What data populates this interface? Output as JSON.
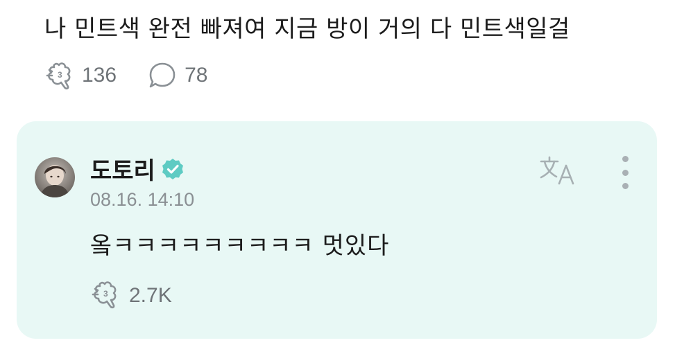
{
  "post": {
    "text": "나 민트색 완전 빠져여 지금 방이 거의 다 민트색일걸",
    "like_icon": "reaction-icon",
    "like_count": "136",
    "comment_icon": "comment-bubble-icon",
    "comment_count": "78"
  },
  "reply": {
    "author": "도토리",
    "verified_icon": "verified-badge-icon",
    "verified_color": "#5ecbc3",
    "timestamp": "08.16. 14:10",
    "text": "옼ㅋㅋㅋㅋㅋㅋㅋㅋㅋ 멋있다",
    "like_icon": "reaction-icon",
    "like_count": "2.7K",
    "translate_icon": "translate-icon",
    "more_icon": "more-vertical-icon",
    "card_color": "#e8f8f5"
  }
}
